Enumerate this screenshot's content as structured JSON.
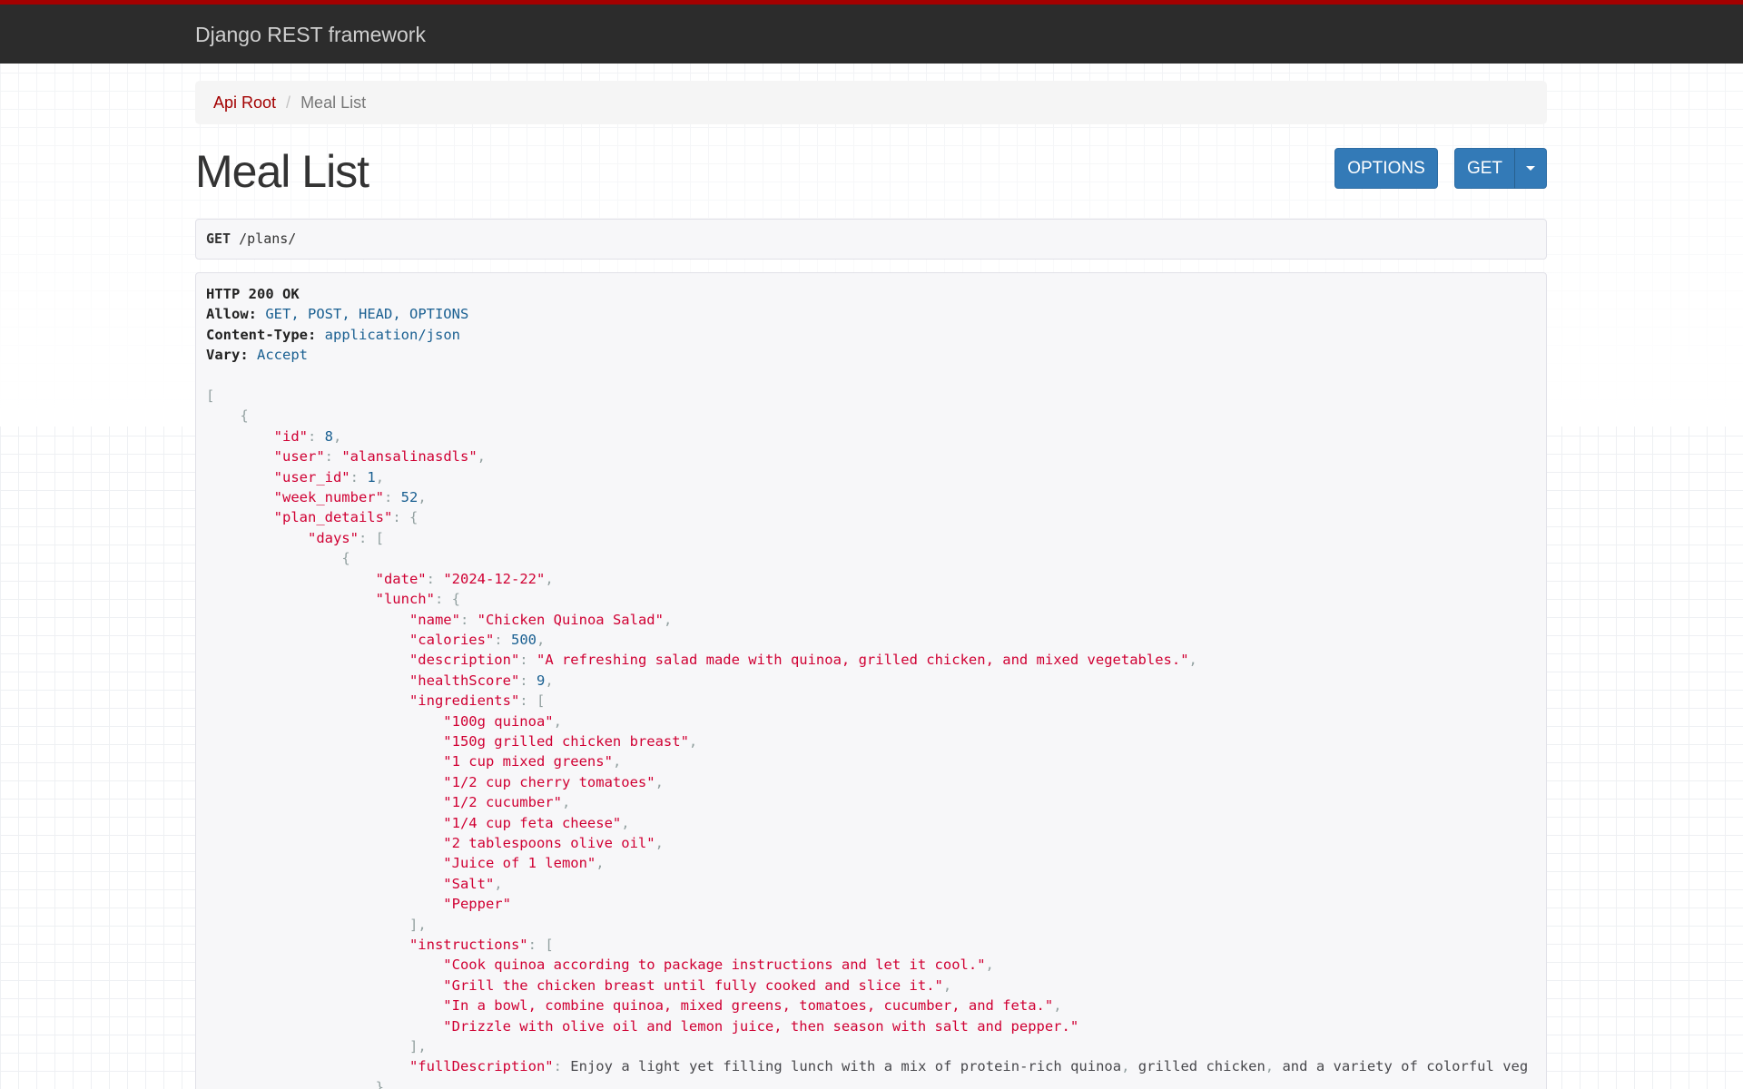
{
  "navbar": {
    "brand": "Django REST framework"
  },
  "breadcrumb": {
    "items": [
      {
        "label": "Api Root",
        "active": false
      },
      {
        "label": "Meal List",
        "active": true
      }
    ],
    "separator": "/"
  },
  "page": {
    "title": "Meal List"
  },
  "buttons": {
    "options_label": "OPTIONS",
    "get_label": "GET"
  },
  "request": {
    "method": "GET",
    "path": "/plans/"
  },
  "response": {
    "status": "HTTP 200 OK",
    "headers": [
      {
        "name": "Allow:",
        "value": "GET, POST, HEAD, OPTIONS"
      },
      {
        "name": "Content-Type:",
        "value": "application/json"
      },
      {
        "name": "Vary:",
        "value": "Accept"
      }
    ],
    "body_lines": [
      "[",
      "    {",
      "        \"id\": 8,",
      "        \"user\": \"alansalinasdls\",",
      "        \"user_id\": 1,",
      "        \"week_number\": 52,",
      "        \"plan_details\": {",
      "            \"days\": [",
      "                {",
      "                    \"date\": \"2024-12-22\",",
      "                    \"lunch\": {",
      "                        \"name\": \"Chicken Quinoa Salad\",",
      "                        \"calories\": 500,",
      "                        \"description\": \"A refreshing salad made with quinoa, grilled chicken, and mixed vegetables.\",",
      "                        \"healthScore\": 9,",
      "                        \"ingredients\": [",
      "                            \"100g quinoa\",",
      "                            \"150g grilled chicken breast\",",
      "                            \"1 cup mixed greens\",",
      "                            \"1/2 cup cherry tomatoes\",",
      "                            \"1/2 cucumber\",",
      "                            \"1/4 cup feta cheese\",",
      "                            \"2 tablespoons olive oil\",",
      "                            \"Juice of 1 lemon\",",
      "                            \"Salt\",",
      "                            \"Pepper\"",
      "                        ],",
      "                        \"instructions\": [",
      "                            \"Cook quinoa according to package instructions and let it cool.\",",
      "                            \"Grill the chicken breast until fully cooked and slice it.\",",
      "                            \"In a bowl, combine quinoa, mixed greens, tomatoes, cucumber, and feta.\",",
      "                            \"Drizzle with olive oil and lemon juice, then season with salt and pepper.\"",
      "                        ],",
      "                        \"fullDescription\": \"Enjoy a light yet filling lunch with a mix of protein-rich quinoa, grilled chicken, and a variety of colorful veg",
      "                    },"
    ]
  },
  "colors": {
    "navbar_bg": "#2c2c2c",
    "accent_red": "#a30000",
    "button_blue": "#337ab7",
    "json_string": "#d00033",
    "json_number": "#195f91"
  },
  "icons": {
    "dropdown": "caret-down-icon"
  }
}
